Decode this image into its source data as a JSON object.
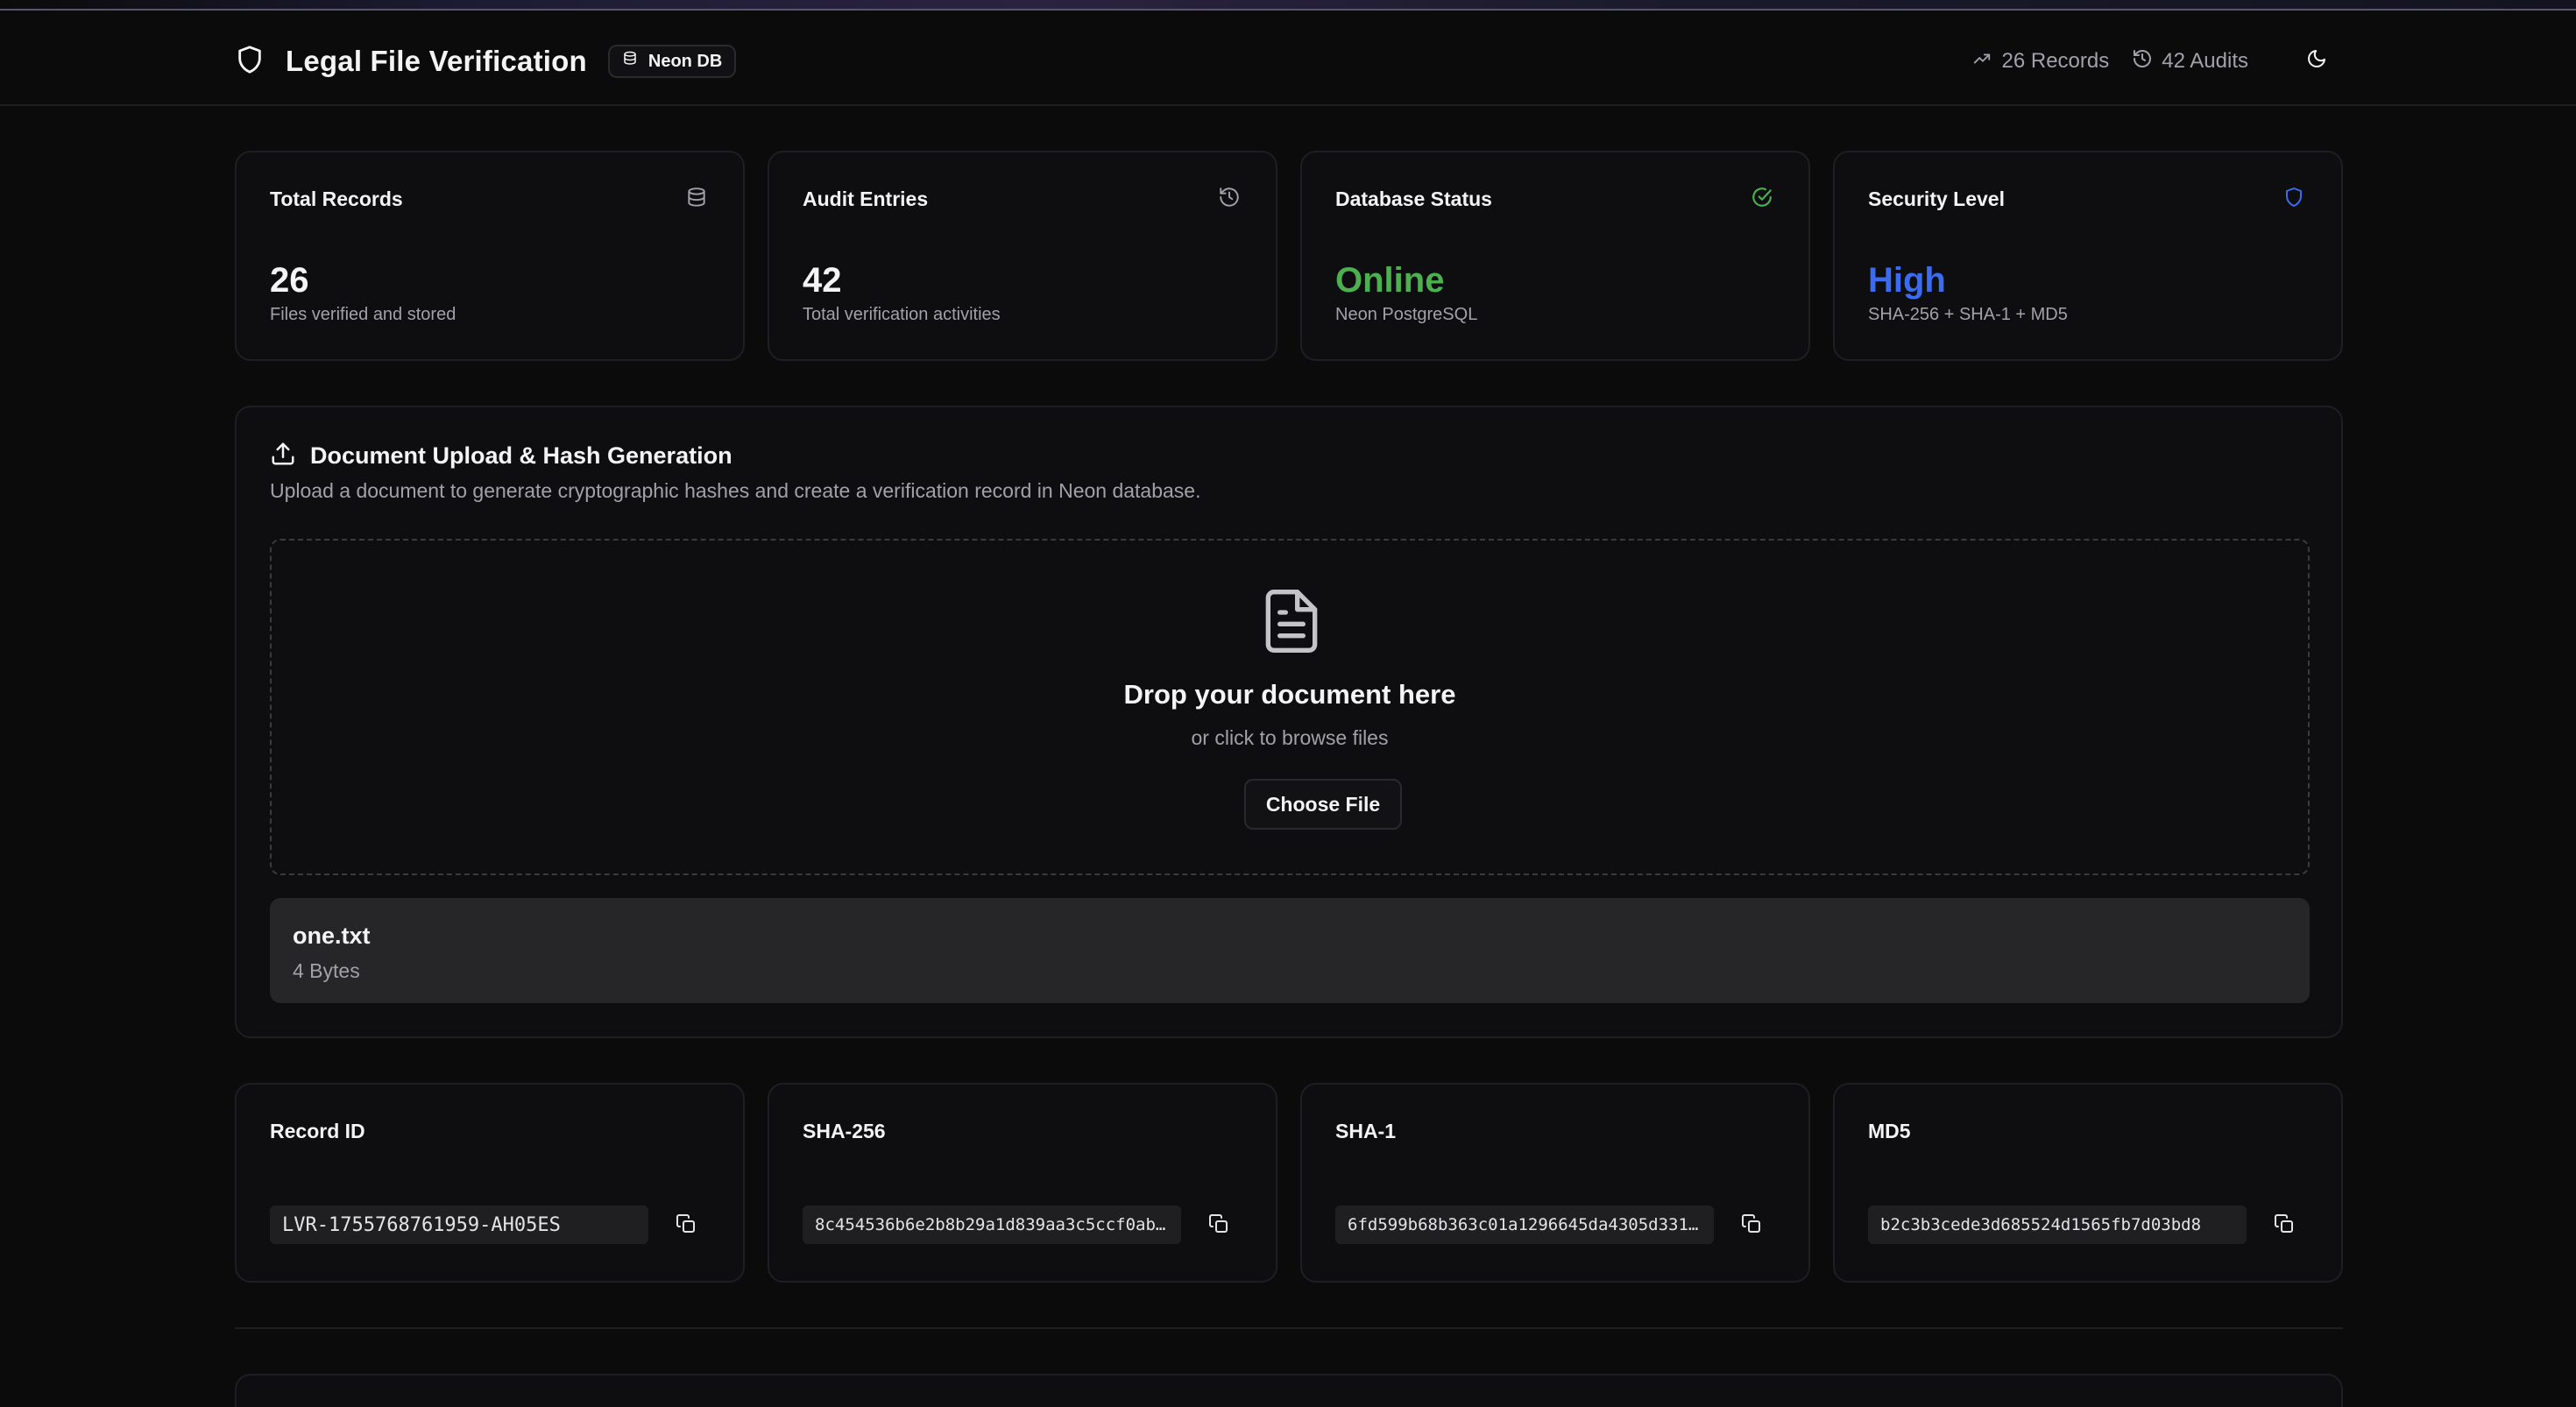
{
  "header": {
    "title": "Legal File Verification",
    "db_badge": "Neon DB",
    "records": "26 Records",
    "audits": "42 Audits"
  },
  "stats": [
    {
      "label": "Total Records",
      "value": "26",
      "sub": "Files verified and stored",
      "icon": "database-icon"
    },
    {
      "label": "Audit Entries",
      "value": "42",
      "sub": "Total verification activities",
      "icon": "history-icon"
    },
    {
      "label": "Database Status",
      "value": "Online",
      "sub": "Neon PostgreSQL",
      "icon": "check-circle-icon",
      "color": "#4caf50"
    },
    {
      "label": "Security Level",
      "value": "High",
      "sub": "SHA-256 + SHA-1 + MD5",
      "icon": "shield-icon",
      "color": "#3b6cf0"
    }
  ],
  "upload": {
    "title": "Document Upload & Hash Generation",
    "description": "Upload a document to generate cryptographic hashes and create a verification record in Neon database.",
    "drop_title": "Drop your document here",
    "drop_sub": "or click to browse files",
    "choose_label": "Choose File",
    "file_name": "one.txt",
    "file_size": "4 Bytes"
  },
  "hashes": [
    {
      "label": "Record ID",
      "value": "LVR-1755768761959-AH05ES"
    },
    {
      "label": "SHA-256",
      "value": "8c454536b6e2b8b29a1d839aa3c5ccf0ab…"
    },
    {
      "label": "SHA-1",
      "value": "6fd599b68b363c01a1296645da4305d331…"
    },
    {
      "label": "MD5",
      "value": "b2c3b3cede3d685524d1565fb7d03bd8"
    }
  ],
  "colors": {
    "online": "#4caf50",
    "high": "#3b6cf0",
    "background": "#0b0b0b"
  }
}
